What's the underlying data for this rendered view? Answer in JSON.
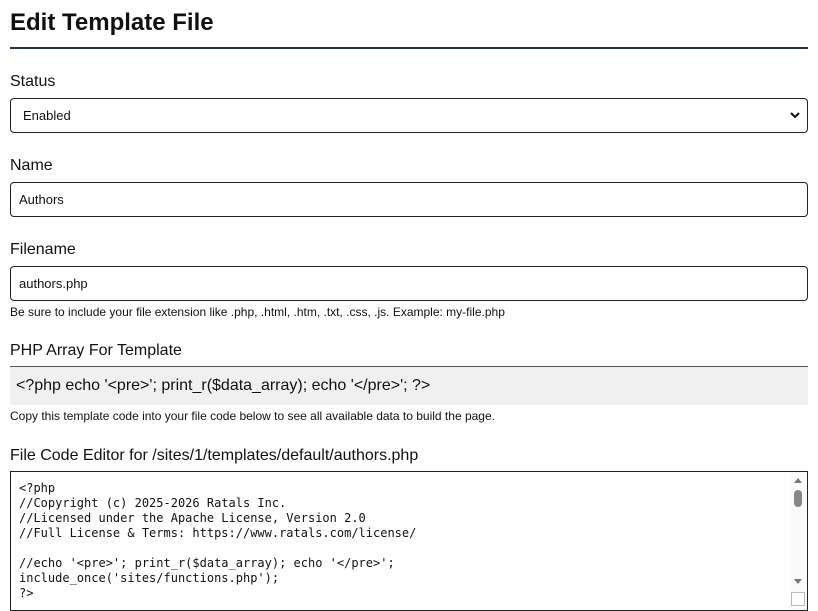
{
  "page": {
    "title": "Edit Template File"
  },
  "status": {
    "label": "Status",
    "selected": "Enabled"
  },
  "name": {
    "label": "Name",
    "value": "Authors"
  },
  "filename": {
    "label": "Filename",
    "value": "authors.php",
    "help": "Be sure to include your file extension like .php, .html, .htm, .txt, .css, .js. Example: my-file.php"
  },
  "php_array": {
    "heading": "PHP Array For Template",
    "code": "<?php echo '<pre>'; print_r($data_array); echo '</pre>'; ?>",
    "help": "Copy this template code into your file code below to see all available data to build the page."
  },
  "editor": {
    "heading": "File Code Editor for /sites/1/templates/default/authors.php",
    "code": "<?php\n//Copyright (c) 2025-2026 Ratals Inc.\n//Licensed under the Apache License, Version 2.0\n//Full License & Terms: https://www.ratals.com/license/\n\n//echo '<pre>'; print_r($data_array); echo '</pre>';\ninclude_once('sites/functions.php');\n?>"
  }
}
